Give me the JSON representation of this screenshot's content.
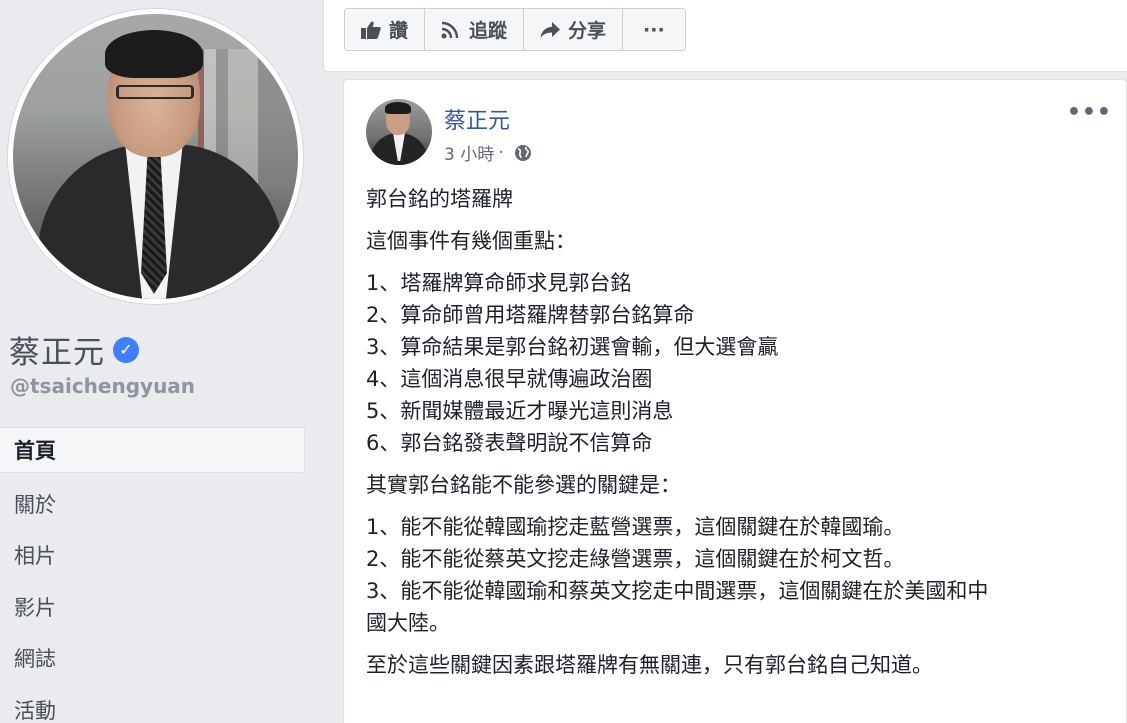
{
  "profile": {
    "name": "蔡正元",
    "handle": "@tsaichengyuan",
    "verified_icon": "check-icon"
  },
  "nav": [
    {
      "label": "首頁",
      "active": true
    },
    {
      "label": "關於"
    },
    {
      "label": "相片"
    },
    {
      "label": "影片"
    },
    {
      "label": "網誌"
    },
    {
      "label": "活動"
    }
  ],
  "actions": {
    "like": "讚",
    "follow": "追蹤",
    "share": "分享",
    "more": "···"
  },
  "post": {
    "author": "蔡正元",
    "time": "3 小時",
    "separator": "·",
    "more": "•••",
    "title": "郭台銘的塔羅牌",
    "intro": "這個事件有幾個重點：",
    "points": [
      "1、塔羅牌算命師求見郭台銘",
      "2、算命師曾用塔羅牌替郭台銘算命",
      "3、算命結果是郭台銘初選會輸，但大選會贏",
      "4、這個消息很早就傳遍政治圈",
      "5、新聞媒體最近才曝光這則消息",
      "6、郭台銘發表聲明說不信算命"
    ],
    "key_intro": "其實郭台銘能不能參選的關鍵是：",
    "keys": [
      "1、能不能從韓國瑜挖走藍營選票，這個關鍵在於韓國瑜。",
      "2、能不能從蔡英文挖走綠營選票，這個關鍵在於柯文哲。",
      "3、能不能從韓國瑜和蔡英文挖走中間選票，這個關鍵在於美國和中",
      "國大陸。"
    ],
    "conclusion": "至於這些關鍵因素跟塔羅牌有無關連，只有郭台銘自己知道。"
  }
}
